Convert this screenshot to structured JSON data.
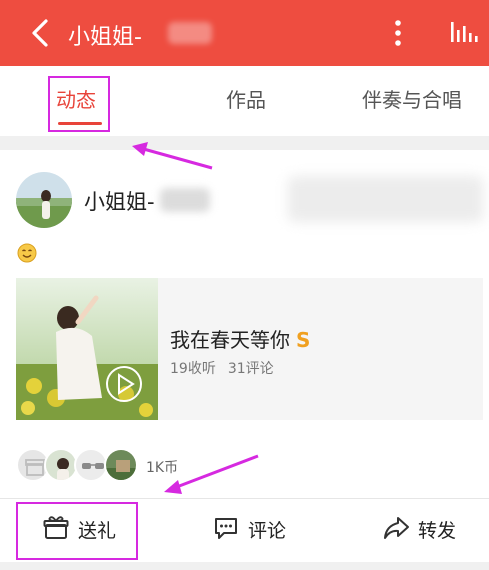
{
  "header": {
    "title": "小姐姐-",
    "back_icon": "chevron-left-icon",
    "more_icon": "more-vertical-icon",
    "chart_icon": "bar-chart-icon",
    "bg_color": "#ee4d40"
  },
  "tabs": [
    {
      "label": "动态",
      "active": true
    },
    {
      "label": "作品",
      "active": false
    },
    {
      "label": "伴奏与合唱",
      "active": false
    }
  ],
  "post": {
    "username": "小姐姐-",
    "emoji": "smile-emoji-icon",
    "song": {
      "title": "我在春天等你",
      "badge": "S",
      "listens": "19收听",
      "comments": "31评论",
      "play_icon": "play-icon"
    },
    "gift_total": "1K币"
  },
  "actions": {
    "gift_label": "送礼",
    "comment_label": "评论",
    "share_label": "转发"
  },
  "colors": {
    "accent": "#e8443a",
    "highlight": "#d629e0",
    "badge": "#f0a020"
  }
}
